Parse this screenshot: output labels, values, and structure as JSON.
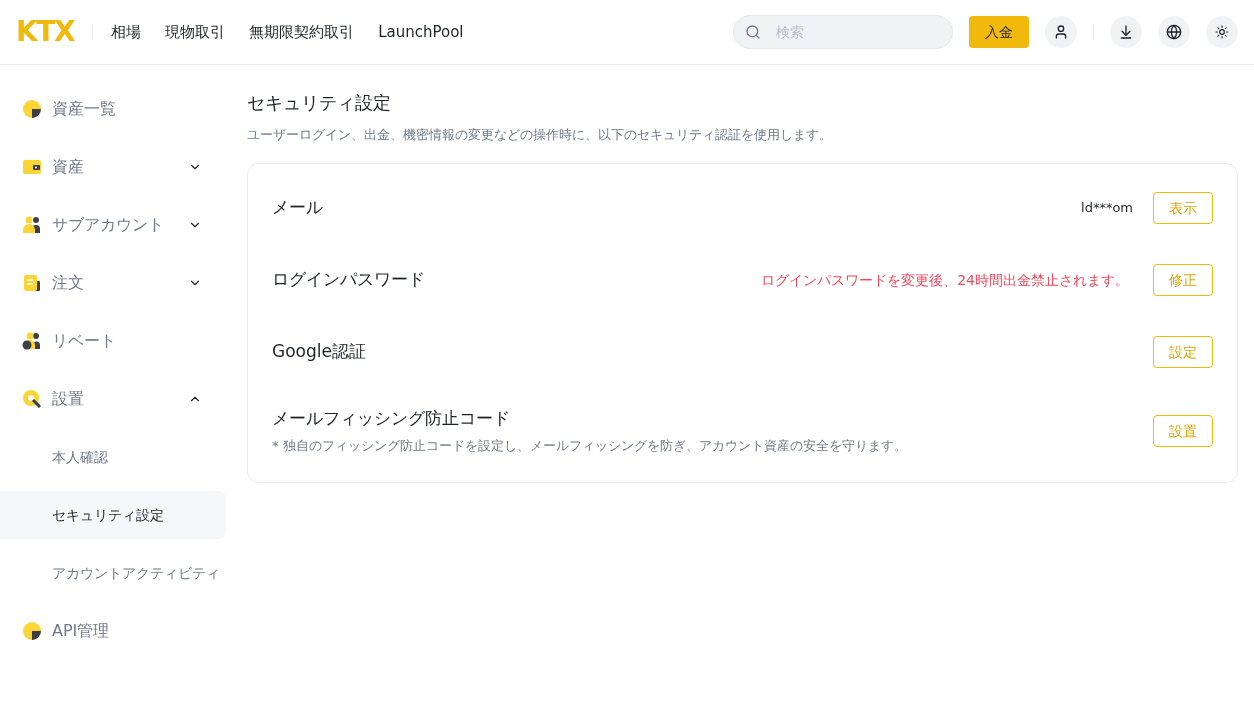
{
  "header": {
    "logo": "KTX",
    "nav": [
      "相場",
      "現物取引",
      "無期限契約取引",
      "LaunchPool"
    ],
    "search": {
      "placeholder": "検索"
    },
    "deposit_button": "入金"
  },
  "sidebar": {
    "items": [
      {
        "label": "資産一覧",
        "kind": "pie"
      },
      {
        "label": "資産",
        "kind": "wallet",
        "expanded": false
      },
      {
        "label": "サブアカウント",
        "kind": "users",
        "expanded": false
      },
      {
        "label": "注文",
        "kind": "doc",
        "expanded": false
      },
      {
        "label": "リベート",
        "kind": "rebate"
      },
      {
        "label": "設置",
        "kind": "gear",
        "expanded": true,
        "children": [
          {
            "label": "本人確認",
            "selected": false
          },
          {
            "label": "セキュリティ設定",
            "selected": true
          },
          {
            "label": "アカウントアクティビティ",
            "selected": false
          }
        ]
      },
      {
        "label": "API管理",
        "kind": "pie"
      }
    ]
  },
  "page": {
    "title": "セキュリティ設定",
    "subtitle": "ユーザーログイン、出金、機密情報の変更などの操作時に、以下のセキュリティ認証を使用します。",
    "rows": [
      {
        "title": "メール",
        "value": "ld***om",
        "button": "表示"
      },
      {
        "title": "ログインパスワード",
        "warning": "ログインパスワードを変更後、24時間出金禁止されます。",
        "button": "修正"
      },
      {
        "title": "Google認証",
        "button": "設定"
      },
      {
        "title": "メールフィッシング防止コード",
        "description": "* 独自のフィッシング防止コードを設定し、メールフィッシングを防ぎ、アカウント資産の安全を守ります。",
        "button": "設置"
      }
    ]
  }
}
